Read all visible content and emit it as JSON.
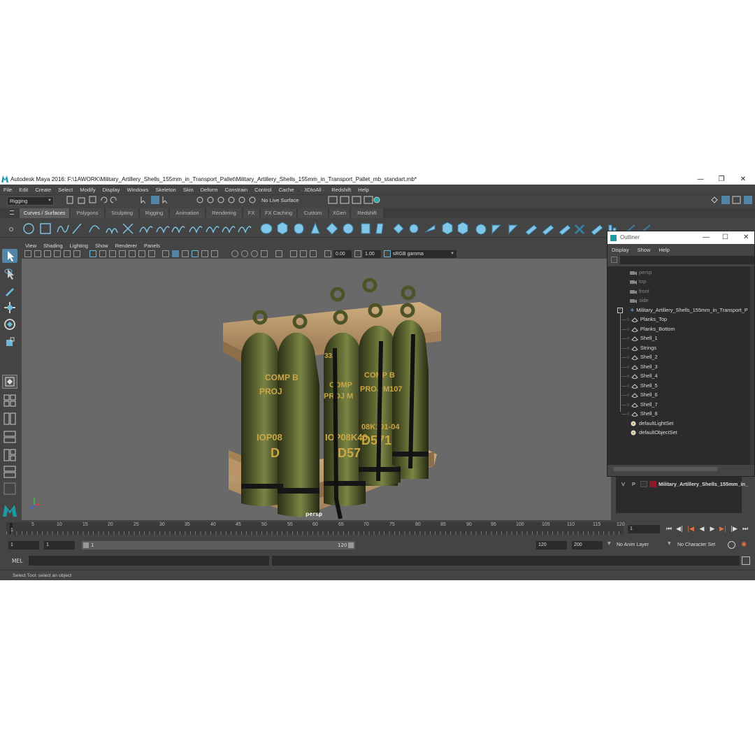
{
  "window": {
    "title": "Autodesk Maya 2016: F:\\1AWORK\\Military_Artillery_Shells_155mm_in_Transport_Pallet\\Military_Artillery_Shells_155mm_in_Transport_Pallet_mb_standart.mb*"
  },
  "menu": [
    "File",
    "Edit",
    "Create",
    "Select",
    "Modify",
    "Display",
    "Windows",
    "Skeleton",
    "Skin",
    "Deform",
    "Constrain",
    "Control",
    "Cache",
    "· 3DtoAll ·",
    "Redshift",
    "Help"
  ],
  "status_line": {
    "menu_set": "Rigging",
    "live_surface": "No Live Surface"
  },
  "shelf_tabs": [
    "Curves / Surfaces",
    "Polygons",
    "Sculpting",
    "Rigging",
    "Animation",
    "Rendering",
    "FX",
    "FX Caching",
    "Custom",
    "XGen",
    "Redshift"
  ],
  "shelf_active_tab": "Curves / Surfaces",
  "viewport": {
    "menu": [
      "View",
      "Shading",
      "Lighting",
      "Show",
      "Renderer",
      "Panels"
    ],
    "exposure": "0.00",
    "gamma": "1.00",
    "color_space": "sRGB gamma",
    "camera": "persp",
    "shell_labels": {
      "comp_b_1": "COMP B",
      "proj_1": "PROJ",
      "code_1": "IOP08",
      "d_1": "D",
      "code_2": "IOP08K40",
      "d_2": "D57",
      "comp_b_2": "COMP B",
      "proj_2": "PROJ M107",
      "code_3": "08K101-04",
      "d_3": "D571",
      "comp_partial": "COMP",
      "proj_partial": "PROJ M",
      "top_num": "331"
    }
  },
  "outliner": {
    "title": "Outliner",
    "menu": [
      "Display",
      "Show",
      "Help"
    ],
    "cameras": [
      "persp",
      "top",
      "front",
      "side"
    ],
    "group": "Military_Artillery_Shells_155mm_in_Transport_P",
    "children": [
      "Planks_Top",
      "Planks_Bottom",
      "Shell_1",
      "Strings",
      "Shell_2",
      "Shell_3",
      "Shell_4",
      "Shell_5",
      "Shell_6",
      "Shell_7",
      "Shell_8"
    ],
    "sets": [
      "defaultLightSet",
      "defaultObjectSet"
    ]
  },
  "layer": {
    "visible": "V",
    "playback": "P",
    "name": "Military_Artillery_Shells_155mm_in_",
    "color": "#8b1a2a"
  },
  "time_slider": {
    "ticks": [
      "5",
      "10",
      "15",
      "20",
      "25",
      "30",
      "35",
      "40",
      "45",
      "50",
      "55",
      "60",
      "65",
      "70",
      "75",
      "80",
      "85",
      "90",
      "95",
      "100",
      "105",
      "110",
      "115",
      "120"
    ],
    "current_marker": "1",
    "current_frame": "1"
  },
  "range_slider": {
    "start": "1",
    "playback_start": "1",
    "range_start_label": "1",
    "range_end_label": "120",
    "playback_end": "120",
    "end": "200",
    "anim_layer": "No Anim Layer",
    "character_set": "No Character Set"
  },
  "command_line": {
    "label": "MEL"
  },
  "help_line": "Select Tool: select an object",
  "colors": {
    "accent": "#5285a6",
    "maya_teal": "#1c9aa6",
    "background": "#444444",
    "viewport": "#696969"
  }
}
